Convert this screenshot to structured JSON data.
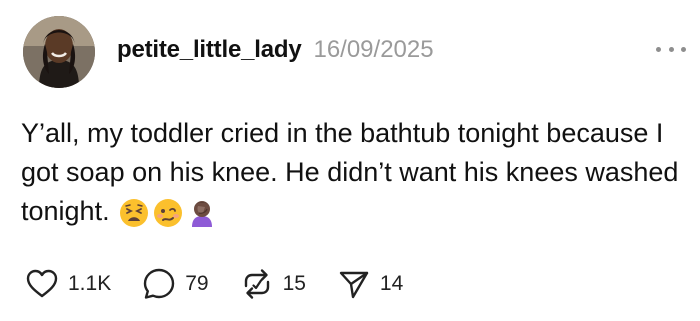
{
  "post": {
    "username": "petite_little_lady",
    "date": "16/09/2025",
    "text": "Y’all, my toddler cried in the bathtub tonight because I got soap on his knee. He didn’t want his knees washed tonight.",
    "emojis": [
      "weary-face",
      "woozy-face",
      "facepalm-woman"
    ],
    "more_icon": "more-horizontal-icon"
  },
  "actions": {
    "likes": {
      "icon": "heart-icon",
      "count": "1.1K"
    },
    "comments": {
      "icon": "comment-icon",
      "count": "79"
    },
    "reposts": {
      "icon": "repost-icon",
      "count": "15"
    },
    "shares": {
      "icon": "send-icon",
      "count": "14"
    }
  }
}
